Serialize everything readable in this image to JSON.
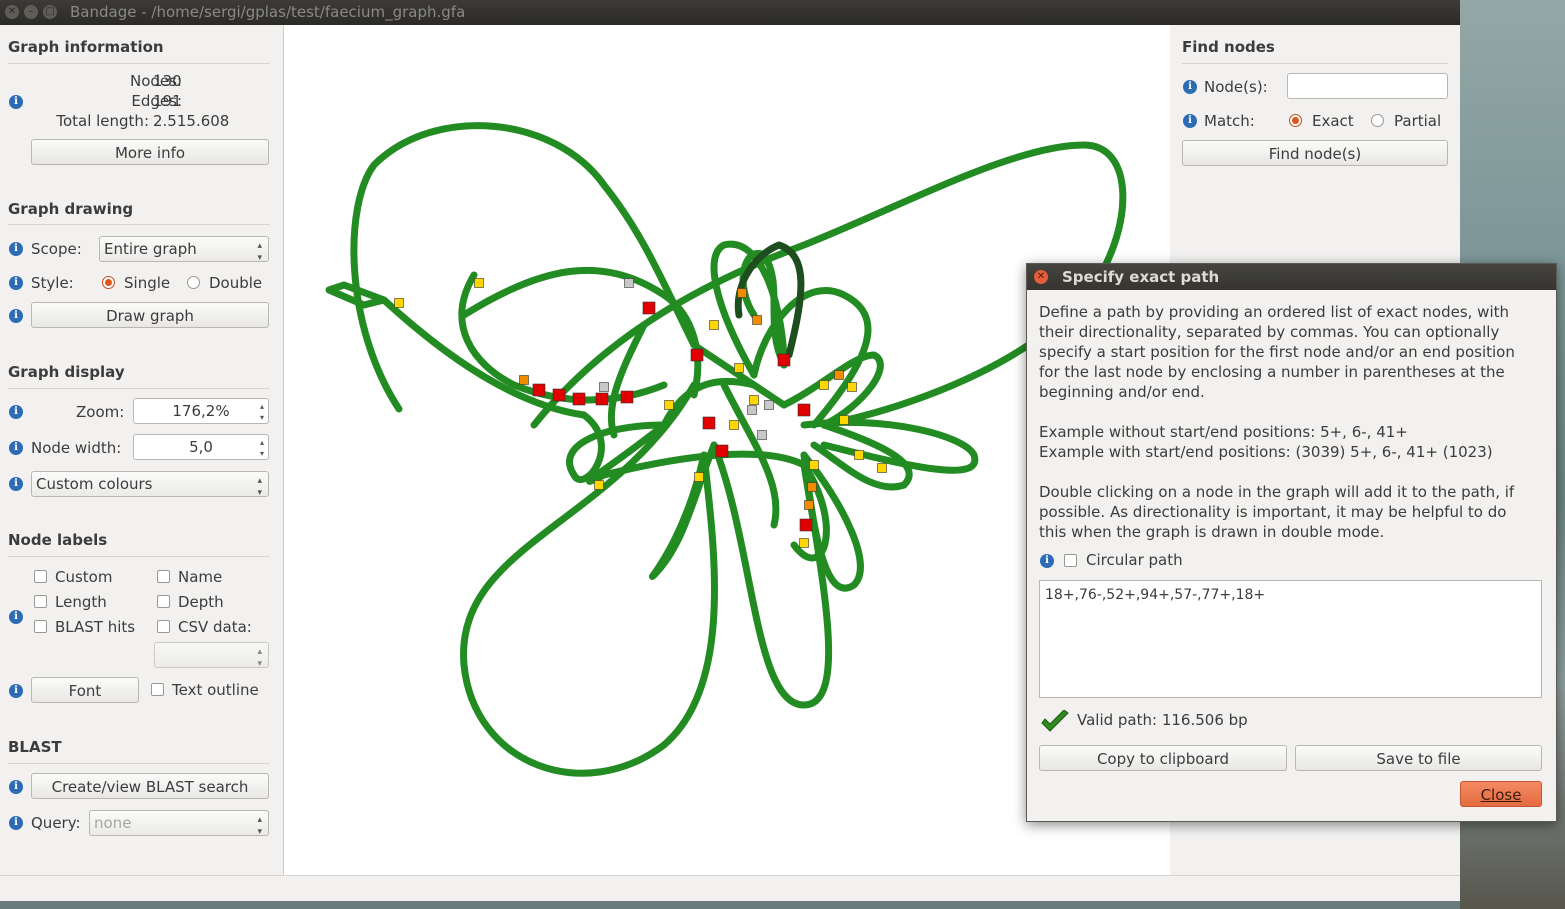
{
  "window": {
    "title": "Bandage - /home/sergi/gplas/test/faecium_graph.gfa"
  },
  "graph_information": {
    "heading": "Graph information",
    "nodes_label": "Nodes:",
    "nodes_value": "130",
    "edges_label": "Edges:",
    "edges_value": "191",
    "total_length_label": "Total length:",
    "total_length_value": "2.515.608",
    "more_info_button": "More info"
  },
  "graph_drawing": {
    "heading": "Graph drawing",
    "scope_label": "Scope:",
    "scope_value": "Entire graph",
    "style_label": "Style:",
    "style_single": "Single",
    "style_double": "Double",
    "style_selected": "Single",
    "draw_button": "Draw graph"
  },
  "graph_display": {
    "heading": "Graph display",
    "zoom_label": "Zoom:",
    "zoom_value": "176,2%",
    "node_width_label": "Node width:",
    "node_width_value": "5,0",
    "colour_scheme": "Custom colours"
  },
  "node_labels": {
    "heading": "Node labels",
    "custom": "Custom",
    "name": "Name",
    "length": "Length",
    "depth": "Depth",
    "blast_hits": "BLAST hits",
    "csv_data": "CSV data:",
    "font_button": "Font",
    "text_outline": "Text outline"
  },
  "blast": {
    "heading": "BLAST",
    "search_button": "Create/view BLAST search",
    "query_label": "Query:",
    "query_value": "none"
  },
  "find_nodes": {
    "heading": "Find nodes",
    "nodes_label": "Node(s):",
    "nodes_value": "",
    "match_label": "Match:",
    "match_exact": "Exact",
    "match_partial": "Partial",
    "match_selected": "Exact",
    "find_button": "Find node(s)"
  },
  "dialog": {
    "title": "Specify exact path",
    "description": [
      "Define a path by providing an ordered list of exact nodes, with",
      "their directionality, separated by commas.  You can optionally",
      "specify a start position for the first node and/or an end position",
      "for the last node by enclosing a number in parentheses at the",
      "beginning and/or end."
    ],
    "example_without": "Example without start/end positions: 5+, 6-, 41+",
    "example_with": "Example with start/end positions: (3039) 5+, 6-, 41+ (1023)",
    "double_click_note": [
      "Double clicking on a node in the graph will add it to the path, if",
      "possible. As directionality is important, it may be helpful to do",
      "this when the graph is drawn in double mode."
    ],
    "circular_path": "Circular path",
    "path_value": "18+,76-,52+,94+,57-,77+,18+",
    "validity": "Valid path: 116.506 bp",
    "copy_button": "Copy to clipboard",
    "save_button": "Save to file",
    "close_button": "Close"
  },
  "colors": {
    "edge_green": "#228b22",
    "path_dark_green": "#1e4d1e",
    "node_red": "#e00000",
    "node_yellow": "#ffd600",
    "node_orange": "#f08c00",
    "node_grey": "#c8c8c8",
    "accent_orange": "#e0541f"
  }
}
